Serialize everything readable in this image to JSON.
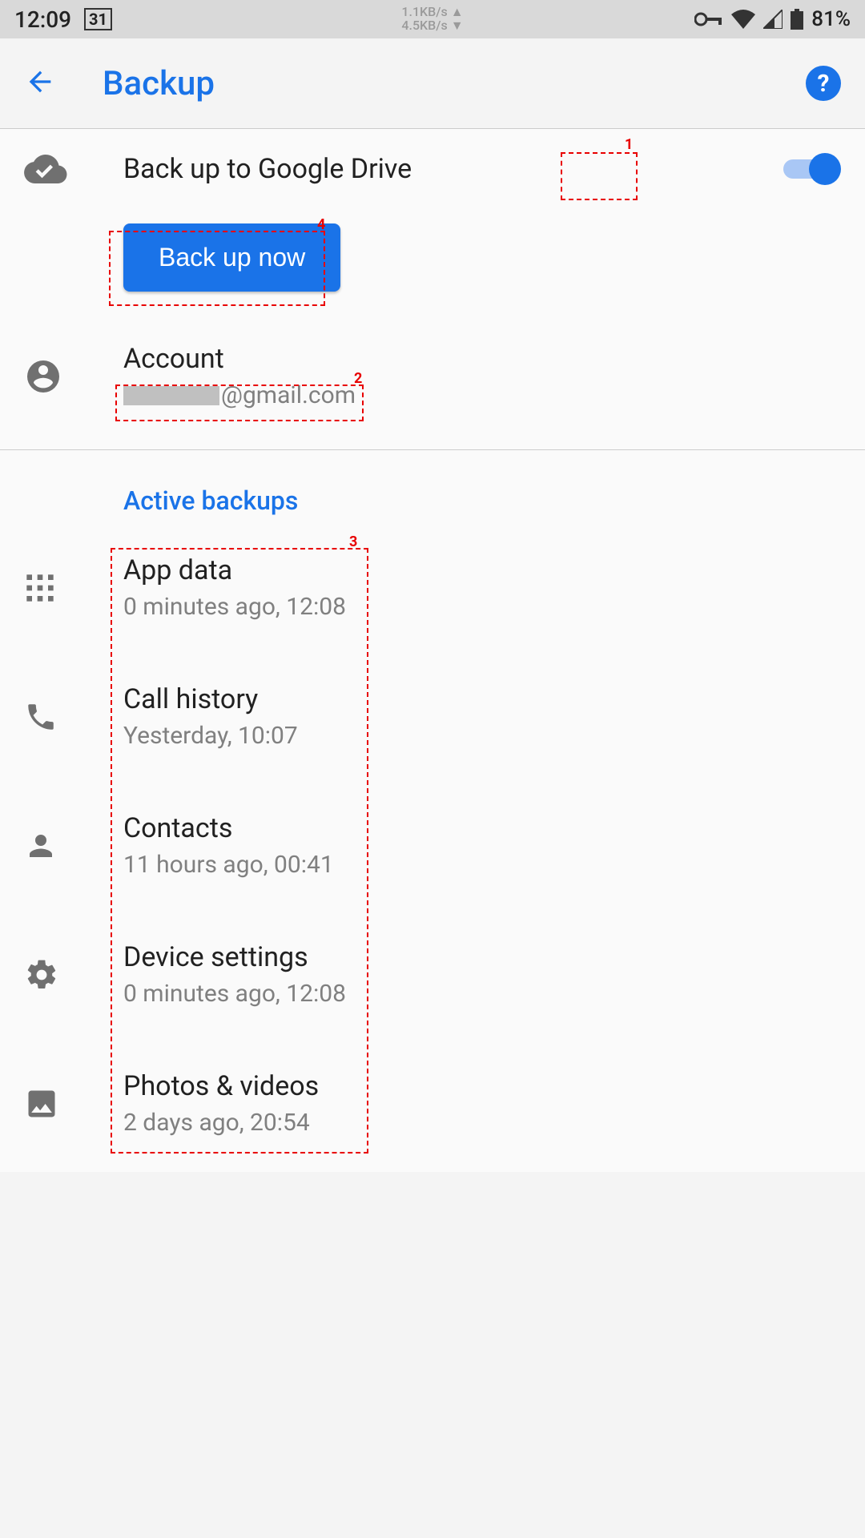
{
  "status": {
    "time": "12:09",
    "date_badge": "31",
    "net_up": "1.1KB/s ▲",
    "net_down": "4.5KB/s ▼",
    "battery_pct": "81%"
  },
  "appbar": {
    "title": "Backup"
  },
  "backup": {
    "drive_label": "Back up to Google Drive",
    "backup_now_label": "Back up now",
    "account_label": "Account",
    "account_email_suffix": "@gmail.com"
  },
  "section": {
    "active_backups": "Active backups"
  },
  "items": [
    {
      "title": "App data",
      "subtitle": "0 minutes ago, 12:08"
    },
    {
      "title": "Call history",
      "subtitle": "Yesterday, 10:07"
    },
    {
      "title": "Contacts",
      "subtitle": "11 hours ago, 00:41"
    },
    {
      "title": "Device settings",
      "subtitle": "0 minutes ago, 12:08"
    },
    {
      "title": "Photos & videos",
      "subtitle": "2 days ago, 20:54"
    }
  ],
  "highlights": {
    "1": "1",
    "2": "2",
    "3": "3",
    "4": "4"
  }
}
